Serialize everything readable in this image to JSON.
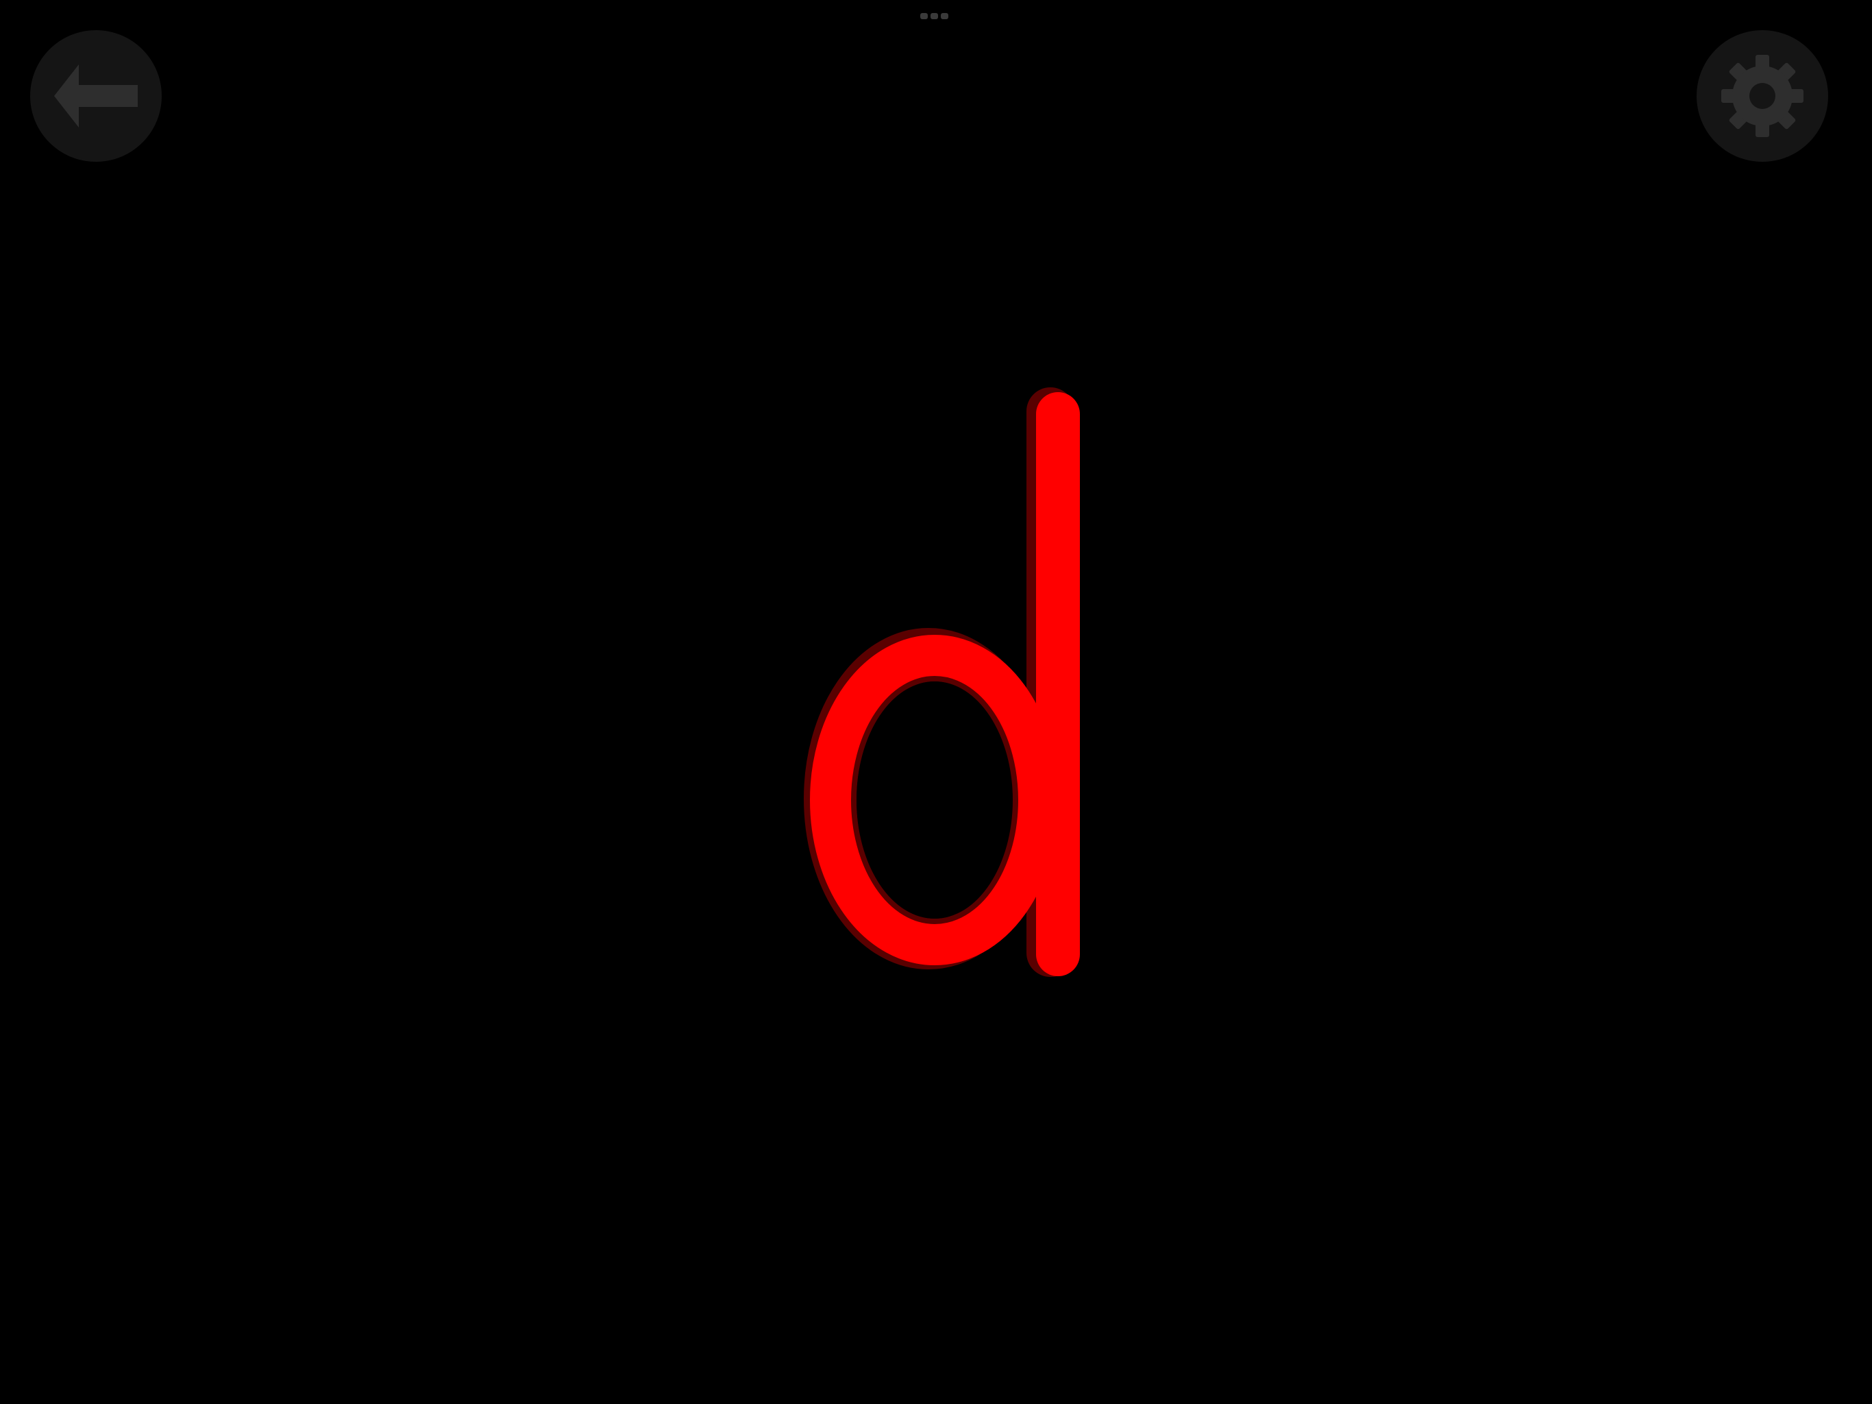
{
  "letter": {
    "character": "d",
    "fill_color": "#ff0000",
    "shadow_color": "#5a0000",
    "background_color": "#000000"
  },
  "toolbar": {
    "back_icon": "arrow-left-icon",
    "settings_icon": "gear-icon",
    "button_color": "#151515",
    "icon_color": "#2e2e2e"
  },
  "multitask_indicator": {
    "icon": "ellipsis-icon"
  }
}
